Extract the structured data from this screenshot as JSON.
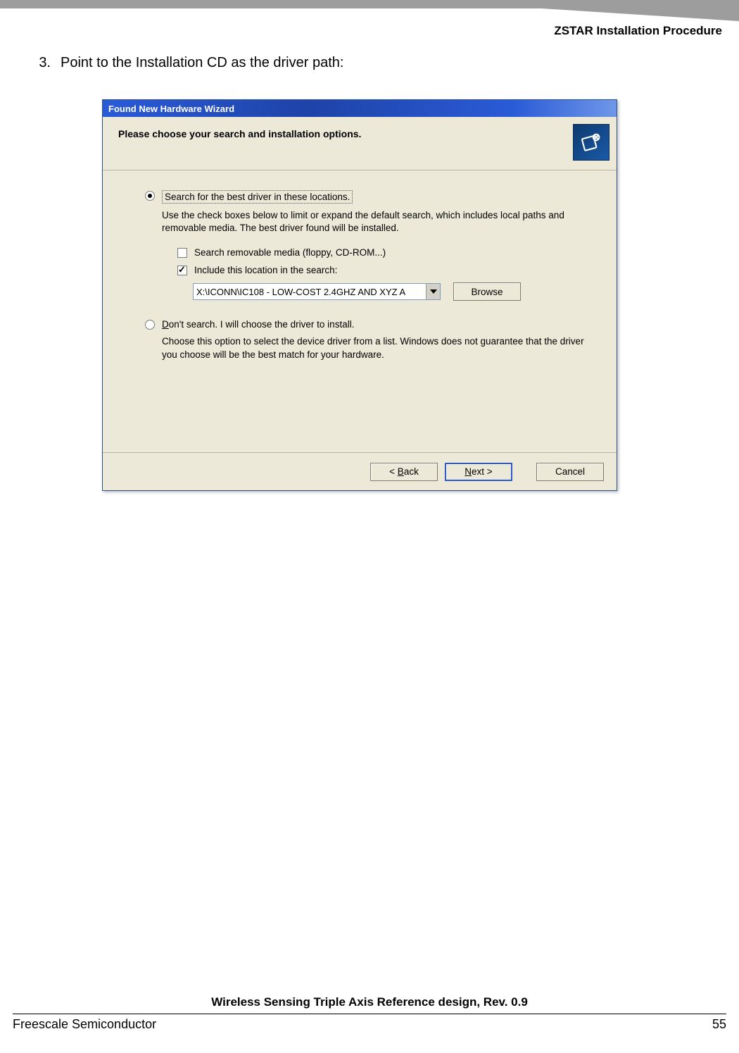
{
  "page": {
    "section_title": "ZSTAR Installation Procedure",
    "step_number": "3.",
    "step_text": "Point to the Installation CD as the driver path:",
    "doc_title": "Wireless Sensing Triple Axis Reference design, Rev. 0.9",
    "company": "Freescale Semiconductor",
    "page_number": "55"
  },
  "dialog": {
    "title": "Found New Hardware Wizard",
    "header_text": "Please choose your search and installation options.",
    "option1": {
      "label": "Search for the best driver in these locations.",
      "description": "Use the check boxes below to limit or expand the default search, which includes local paths and removable media. The best driver found will be installed.",
      "checkbox1": "Search removable media (floppy, CD-ROM...)",
      "checkbox2": "Include this location in the search:",
      "location_value": "X:\\ICONN\\IC108 - LOW-COST 2.4GHZ AND XYZ A",
      "browse_label": "Browse"
    },
    "option2": {
      "label_pre": "D",
      "label_rest": "on't search. I will choose the driver to install.",
      "description": "Choose this option to select the device driver from a list.  Windows does not guarantee that the driver you choose will be the best match for your hardware."
    },
    "buttons": {
      "back_pre": "< ",
      "back_u": "B",
      "back_rest": "ack",
      "next_u": "N",
      "next_rest": "ext >",
      "cancel": "Cancel"
    }
  }
}
